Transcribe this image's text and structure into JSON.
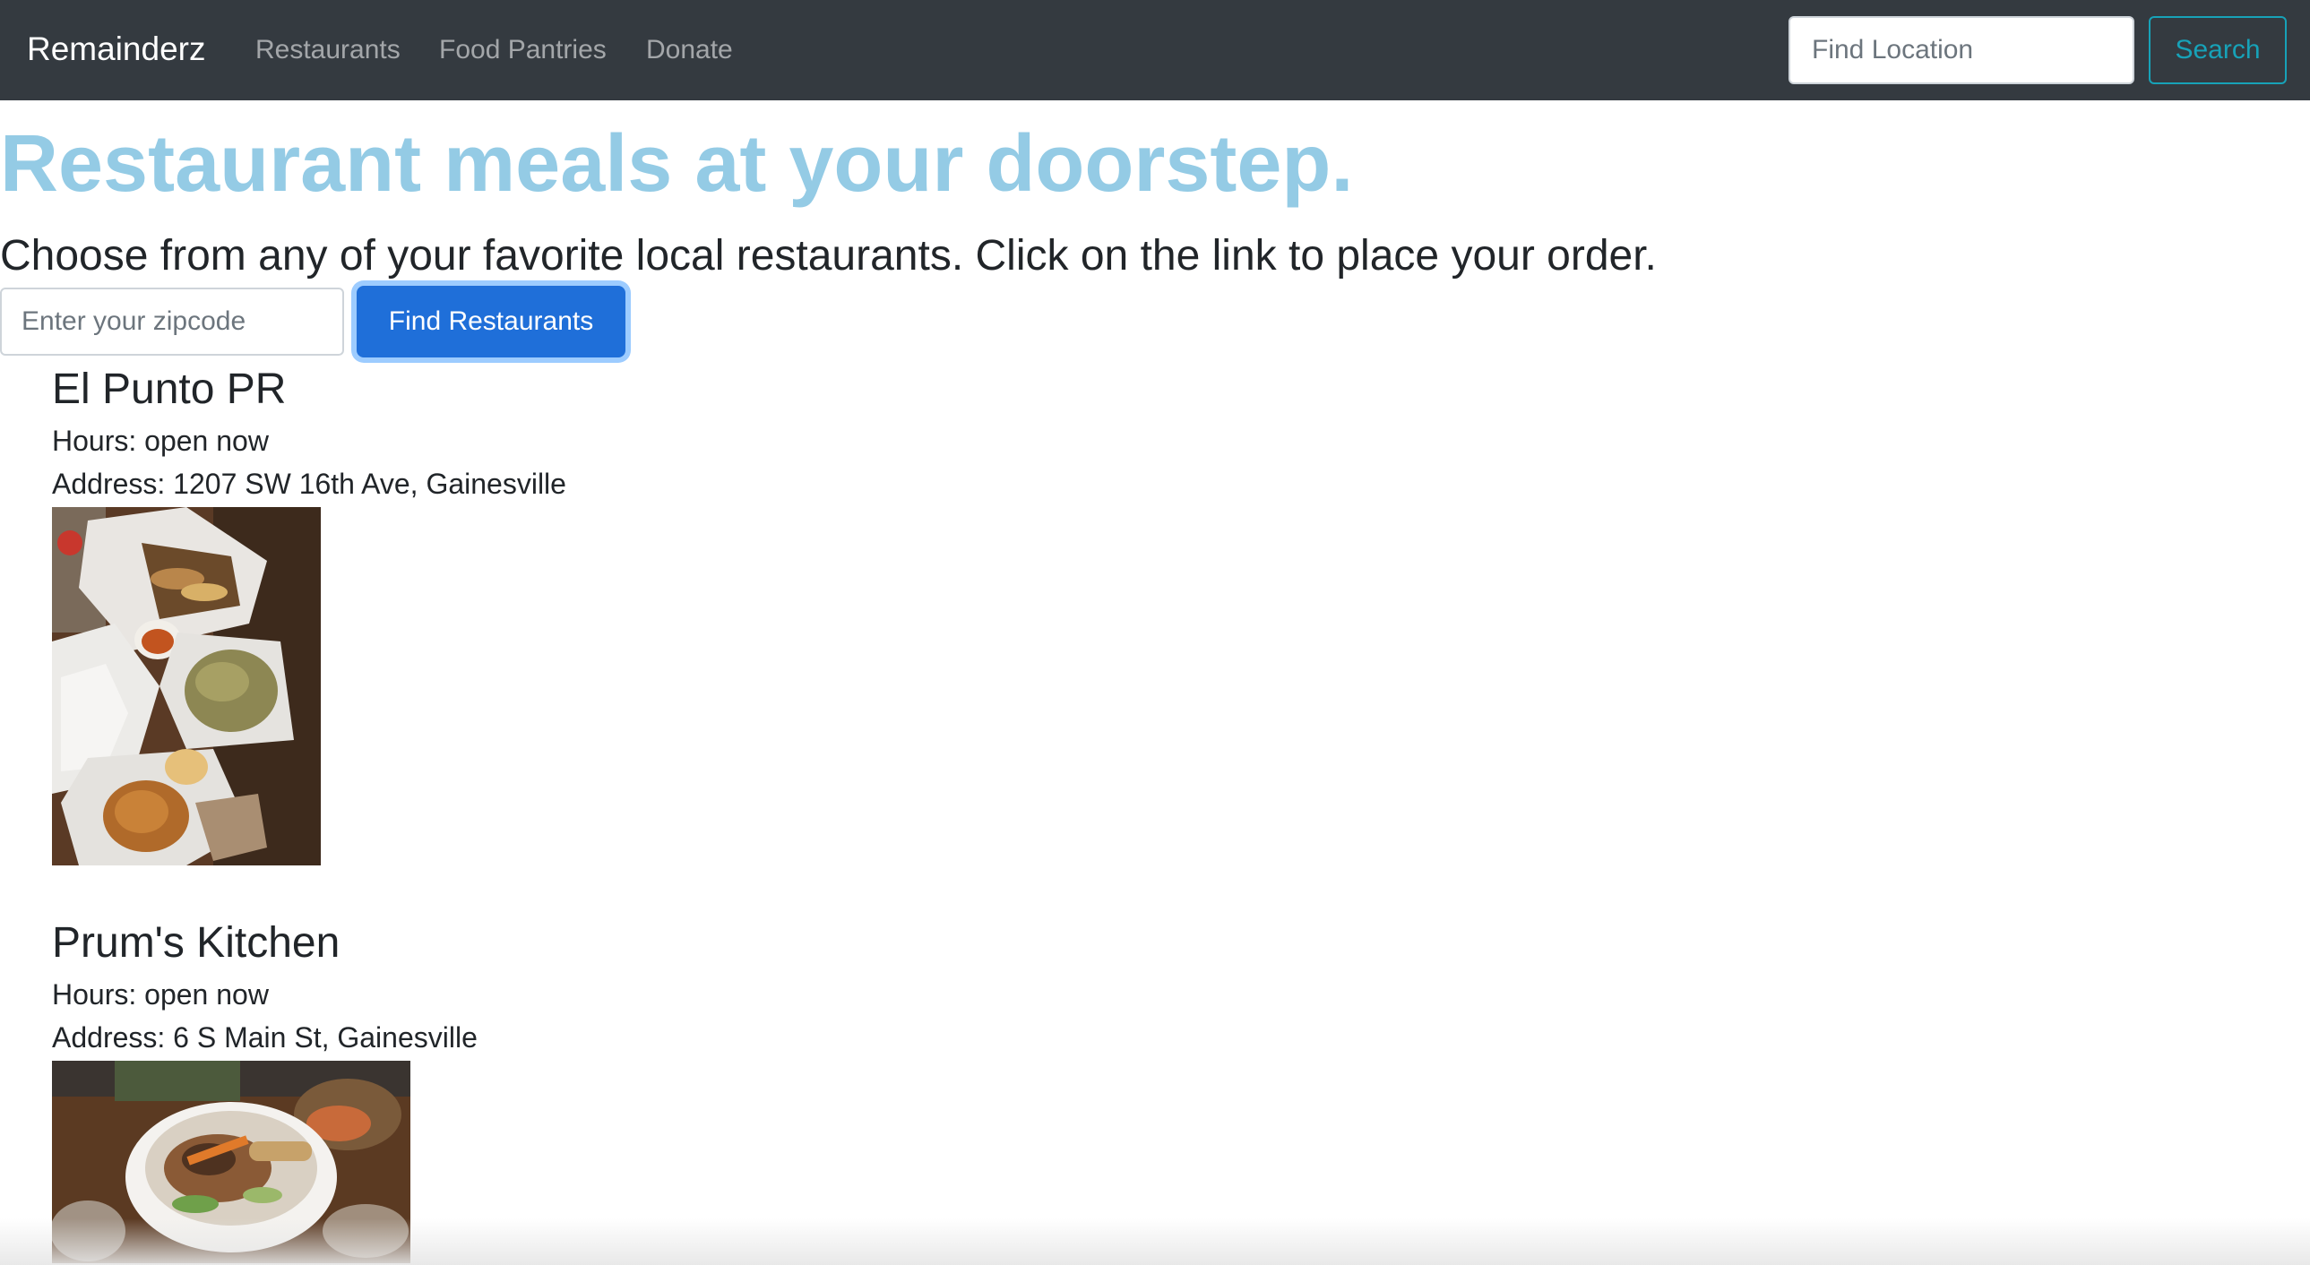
{
  "navbar": {
    "brand": "Remainderz",
    "links": [
      "Restaurants",
      "Food Pantries",
      "Donate"
    ],
    "search_placeholder": "Find Location",
    "search_button": "Search"
  },
  "hero": {
    "title": "Restaurant meals at your doorstep.",
    "subtitle": "Choose from any of your favorite local restaurants. Click on the link to place your order.",
    "zip_placeholder": "Enter your zipcode",
    "find_button": "Find Restaurants"
  },
  "restaurants": [
    {
      "name": "El Punto PR",
      "hours": "Hours: open now",
      "address": "Address: 1207 SW 16th Ave, Gainesville",
      "photo": "takeout-containers-food-photo"
    },
    {
      "name": "Prum's Kitchen",
      "hours": "Hours: open now",
      "address": "Address: 6 S Main St, Gainesville",
      "photo": "noodle-bowl-food-photo"
    }
  ],
  "colors": {
    "navbar_bg": "#343a40",
    "hero_title": "#94cbe5",
    "primary_button": "#1f6fd9",
    "search_outline": "#17a2b8"
  }
}
